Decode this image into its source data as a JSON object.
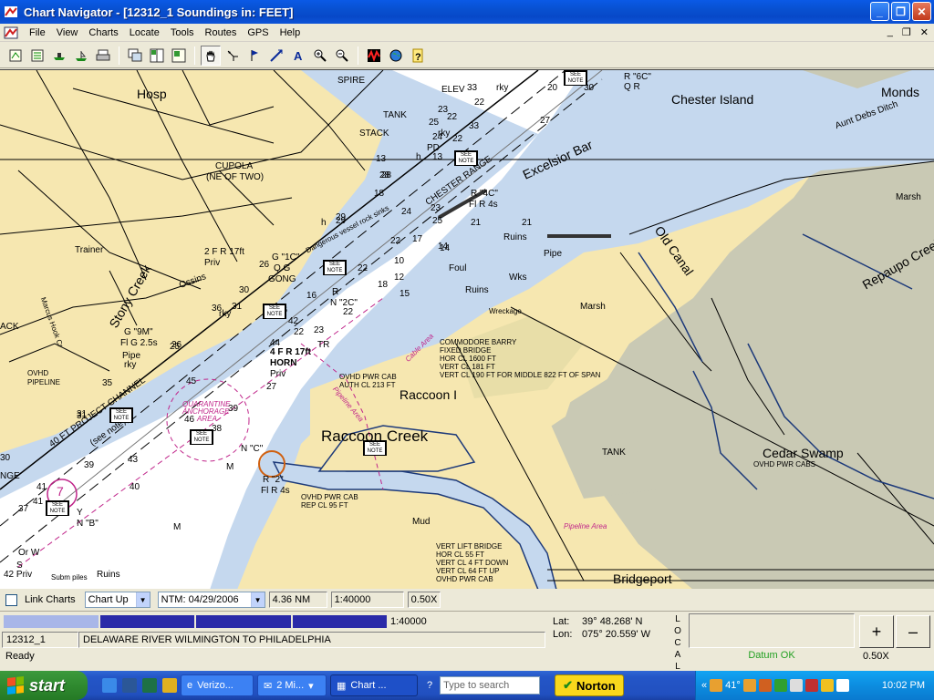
{
  "window": {
    "title": "Chart Navigator - [12312_1 Soundings in: FEET]"
  },
  "menu": [
    "File",
    "View",
    "Charts",
    "Locate",
    "Tools",
    "Routes",
    "GPS",
    "Help"
  ],
  "chart_labels": {
    "chester_island": "Chester Island",
    "monds": "Monds",
    "aunt_debs": "Aunt Debs Ditch",
    "marsh_right": "Marsh",
    "repaupo": "Repaupo Creek",
    "marsh_mid": "Marsh",
    "old_canal": "Old Canal",
    "hosp": "Hosp",
    "spire": "SPIRE",
    "elev": "ELEV",
    "tank_top": "TANK",
    "stack": "STACK",
    "cupola": "CUPOLA",
    "cupola2": "(NE OF TWO)",
    "trainer": "Trainer",
    "stony": "Stony Creek",
    "ossins": "Ossins",
    "excelsior": "Excelsior Bar",
    "chester_range": "CHESTER RANGE",
    "r4c": "R \"4C\"",
    "r4c_fl": "Fl R 4s",
    "r6c": "R \"6C\"",
    "r6c_q": "Q R",
    "ruins1": "Ruins",
    "ruins2": "Ruins",
    "ruins3": "Ruins",
    "pipe": "Pipe",
    "foul": "Foul",
    "wks": "Wks",
    "wreckage": "Wreckage",
    "g1c": "G \"1C\"",
    "qg": "Q G",
    "gong": "GONG",
    "fr17": "2 F R 17ft",
    "priv1": "Priv",
    "rn2c": "R",
    "rn2c2": "N \"2C\"",
    "fr17b": "4 F R 17ft",
    "horn": "HORN",
    "priv2": "Priv",
    "tr": "TR",
    "dang_area": "Dangerous vessel rock sinks",
    "g9m": "G \"9M\"",
    "flg25": "Fl G 2.5s",
    "pipe_left": "Pipe",
    "ovhd_pipeline": "OVHD",
    "ovhd_pipeline2": "PIPELINE",
    "project_channel": "40 FT PROJECT CHANNEL",
    "see_note": "(see note)",
    "quarantine1": "QUARANTINE",
    "quarantine2": "ANCHORAGE",
    "quarantine3": "AREA",
    "commodore1": "COMMODORE BARRY",
    "commodore2": "FIXED BRIDGE",
    "commodore3": "HOR CL 1600 FT",
    "commodore4": "VERT CL 181 FT",
    "commodore5": "VERT CL 190 FT FOR MIDDLE 822 FT OF SPAN",
    "ovhd_pwr1": "OVHD PWR CAB",
    "ovhd_pwr2": "AUTH CL 213 FT",
    "raccoon_i": "Raccoon I",
    "raccoon_creek": "Raccoon Creek",
    "pipeline_area": "Pipeline Area",
    "cable_area": "Cable Area",
    "tank_mid": "TANK",
    "cedar_swamp": "Cedar Swamp",
    "cedar_cabs": "OVHD PWR CABS",
    "nc": "N \"C\"",
    "r2": "R \"2\"",
    "flr4": "Fl R 4s",
    "ovhd_pwr3": "OVHD PWR CAB",
    "ovhd_pwr4": "REP CL 95 FT",
    "mud": "Mud",
    "lift1": "VERT LIFT BRIDGE",
    "lift2": "HOR CL 55 FT",
    "lift3": "VERT CL 4 FT DOWN",
    "lift4": "VERT CL 64 FT UP",
    "lift5": "OVHD PWR CAB",
    "pipeline_area2": "Pipeline Area",
    "bridgeport": "Bridgeport",
    "yn_b": "Y",
    "n_b": "N \"B\"",
    "orw": "Or W",
    "s": "S",
    "priv3": "42 Priv",
    "subm": "Subm piles",
    "ruins4": "Ruins",
    "ack": "ACK",
    "marcus": "Marcus Hook Cr",
    "m1": "M",
    "m2": "M",
    "h1": "h",
    "h2": "h",
    "rky1": "rky",
    "rky2": "rky",
    "rky3": "rky",
    "rky4": "rky",
    "pd": "PD",
    "nge": "NGE",
    "circle7": "7"
  },
  "see_note": {
    "top": "SEE",
    "bottom": "NOTE"
  },
  "soundings": [
    "30",
    "20",
    "22",
    "23",
    "27",
    "25",
    "22",
    "13",
    "33",
    "24",
    "22",
    "28",
    "13",
    "18",
    "29",
    "24",
    "23",
    "25",
    "22",
    "17",
    "14",
    "12",
    "10",
    "26",
    "22",
    "21",
    "23",
    "18",
    "22",
    "21",
    "15",
    "16",
    "14",
    "44",
    "42",
    "36",
    "31",
    "30",
    "29",
    "28",
    "25",
    "45",
    "46",
    "39",
    "38",
    "41",
    "43",
    "39",
    "40",
    "35",
    "36",
    "31",
    "27",
    "26",
    "22",
    "33",
    "30",
    "31",
    "37",
    "41"
  ],
  "controls": {
    "link_charts": "Link Charts",
    "chart_up": "Chart Up",
    "ntm": "NTM: 04/29/2006",
    "range": "4.36 NM",
    "scale": "1:40000",
    "zoom": "0.50X"
  },
  "info": {
    "scale2": "1:40000",
    "chart_id": "12312_1",
    "chart_name": "DELAWARE RIVER WILMINGTON TO PHILADELPHIA",
    "status": "Ready",
    "lat_label": "Lat:",
    "lat": "39° 48.268' N",
    "lon_label": "Lon:",
    "lon": "075° 20.559' W",
    "local": "LOCAL",
    "datum": "Datum OK",
    "zoom_in": "+",
    "zoom_out": "–",
    "zoom2": "0.50X"
  },
  "taskbar": {
    "start": "start",
    "tasks": [
      "Verizo...",
      "2 Mi...",
      "Chart ..."
    ],
    "search_placeholder": "Type to search",
    "norton": "Norton",
    "temp": "41°",
    "clock": "10:02 PM"
  },
  "colors": {
    "land": "#f6e7b0",
    "shallow_water": "#c5d8ee",
    "deep_water": "#ffffff",
    "marsh": "#c9c9b4",
    "magenta": "#c0258a"
  }
}
